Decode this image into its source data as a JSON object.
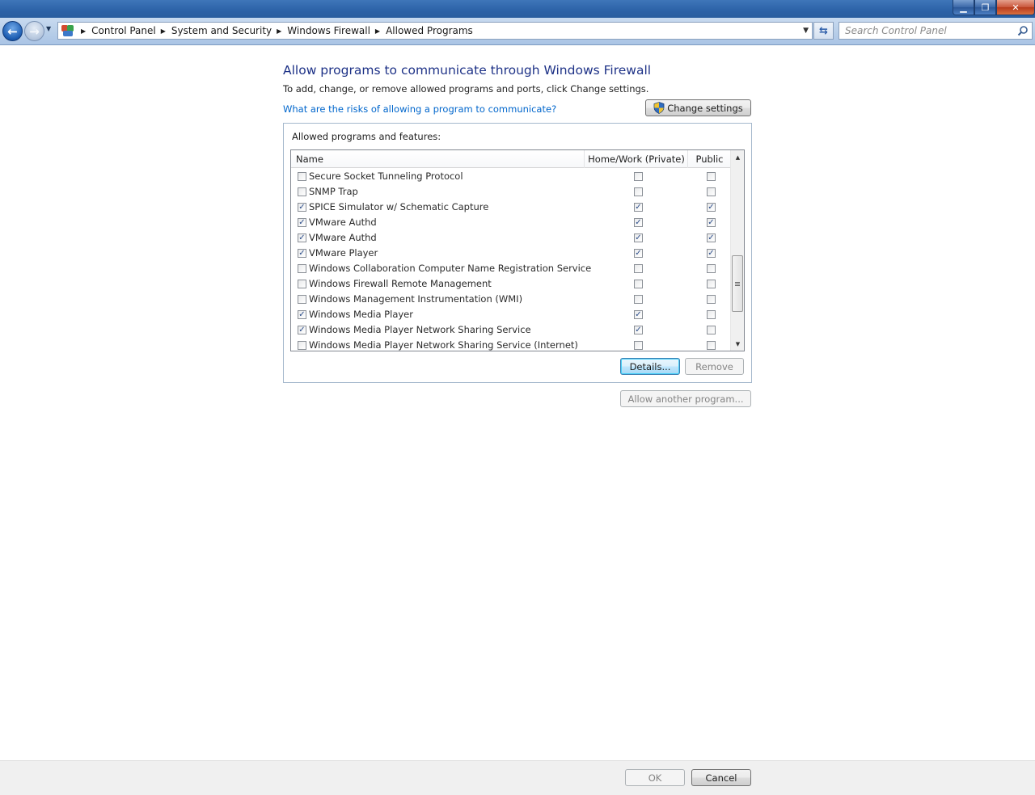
{
  "window": {
    "minimize": "▁",
    "maximize": "❐",
    "close": "✕"
  },
  "nav": {
    "back_icon": "←",
    "forward_icon": "→",
    "breadcrumbs": [
      "Control Panel",
      "System and Security",
      "Windows Firewall",
      "Allowed Programs"
    ],
    "search_placeholder": "Search Control Panel",
    "refresh_icon": "⇆"
  },
  "content": {
    "title": "Allow programs to communicate through Windows Firewall",
    "description": "To add, change, or remove allowed programs and ports, click Change settings.",
    "risk_link": "What are the risks of allowing a program to communicate?",
    "change_settings_label": "Change settings",
    "group_label": "Allowed programs and features:"
  },
  "table": {
    "columns": {
      "name": "Name",
      "private": "Home/Work (Private)",
      "public": "Public"
    },
    "rows": [
      {
        "name": "Secure Socket Tunneling Protocol",
        "enabled": false,
        "private": false,
        "public": false
      },
      {
        "name": "SNMP Trap",
        "enabled": false,
        "private": false,
        "public": false
      },
      {
        "name": "SPICE Simulator w/ Schematic Capture",
        "enabled": true,
        "private": true,
        "public": true
      },
      {
        "name": "VMware Authd",
        "enabled": true,
        "private": true,
        "public": true
      },
      {
        "name": "VMware Authd",
        "enabled": true,
        "private": true,
        "public": true
      },
      {
        "name": "VMware Player",
        "enabled": true,
        "private": true,
        "public": true
      },
      {
        "name": "Windows Collaboration Computer Name Registration Service",
        "enabled": false,
        "private": false,
        "public": false
      },
      {
        "name": "Windows Firewall Remote Management",
        "enabled": false,
        "private": false,
        "public": false
      },
      {
        "name": "Windows Management Instrumentation (WMI)",
        "enabled": false,
        "private": false,
        "public": false
      },
      {
        "name": "Windows Media Player",
        "enabled": true,
        "private": true,
        "public": false
      },
      {
        "name": "Windows Media Player Network Sharing Service",
        "enabled": true,
        "private": true,
        "public": false
      },
      {
        "name": "Windows Media Player Network Sharing Service (Internet)",
        "enabled": false,
        "private": false,
        "public": false
      }
    ]
  },
  "buttons": {
    "details": "Details...",
    "remove": "Remove",
    "allow_another": "Allow another program...",
    "ok": "OK",
    "cancel": "Cancel"
  },
  "colors": {
    "title": "#1e3287",
    "link": "#0066cc",
    "check": "#2c4d8a"
  }
}
